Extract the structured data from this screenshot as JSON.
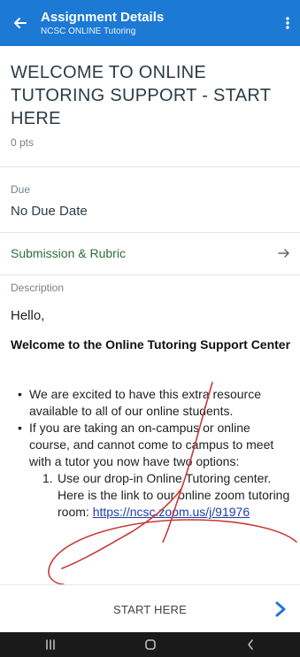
{
  "header": {
    "title": "Assignment Details",
    "subtitle": "NCSC ONLINE Tutoring",
    "back_icon": "back-arrow-icon",
    "menu_icon": "more-vert-icon",
    "color": "#1c7ad4"
  },
  "assignment": {
    "title": "WELCOME TO ONLINE TUTORING SUPPORT - START HERE",
    "points": "0 pts",
    "due_label": "Due",
    "due_value": "No Due Date",
    "submission_label": "Submission & Rubric",
    "description_label": "Description"
  },
  "description": {
    "greeting": "Hello,",
    "heading": "Welcome to the Online Tutoring Support Center",
    "bullets": [
      "We are excited to have this extra resource available to all of our online students.",
      "If you are taking an on-campus or online course, and cannot come to campus to meet with a tutor you now have two options:"
    ],
    "numbered": [
      {
        "num": "1.",
        "text": "Use our drop-in Online Tutoring center. Here is the link to our online zoom tutoring room:",
        "link": "https://ncsc.zoom.us/j/91976"
      }
    ]
  },
  "footer": {
    "label": "START HERE",
    "next_icon": "chevron-right-icon",
    "accent": "#1c7ad4"
  },
  "system_nav": {
    "recents_icon": "recents-icon",
    "home_icon": "home-icon",
    "back_icon": "nav-back-icon"
  },
  "annotation": {
    "color": "#c73b3b"
  }
}
